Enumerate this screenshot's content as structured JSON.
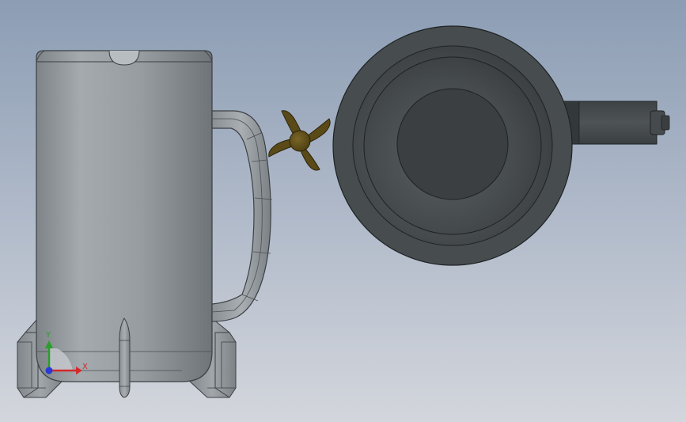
{
  "view": {
    "background_top": "#8c9db4",
    "background_bottom": "#d3d6dc"
  },
  "triad": {
    "x_label": "X",
    "y_label": "Y",
    "x_color": "#d42a2a",
    "y_color": "#2a9e2a",
    "z_color": "#2a3ad4"
  },
  "colors": {
    "mug_body": "#9aa0a4",
    "mug_edge": "#3c4044",
    "top_view_outer": "#474c4e",
    "top_view_inner": "#3b3f41",
    "knob": "#5a4a18"
  }
}
